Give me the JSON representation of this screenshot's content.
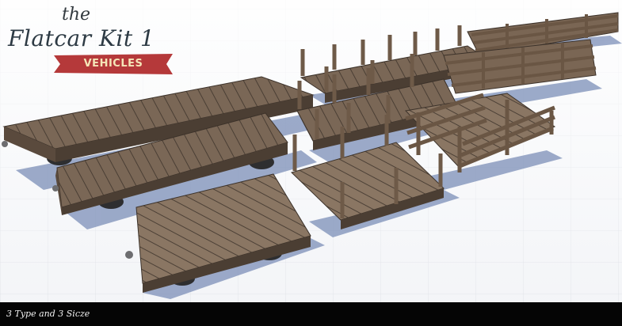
{
  "title": {
    "small": "the",
    "main": "Flatcar Kit 1",
    "ribbon": "VEHICLES"
  },
  "caption": "3 Type and 3 Sicze",
  "colors": {
    "ribbon": "#b5393a",
    "wood": "#7d6a58",
    "caption_bar": "#050505"
  }
}
